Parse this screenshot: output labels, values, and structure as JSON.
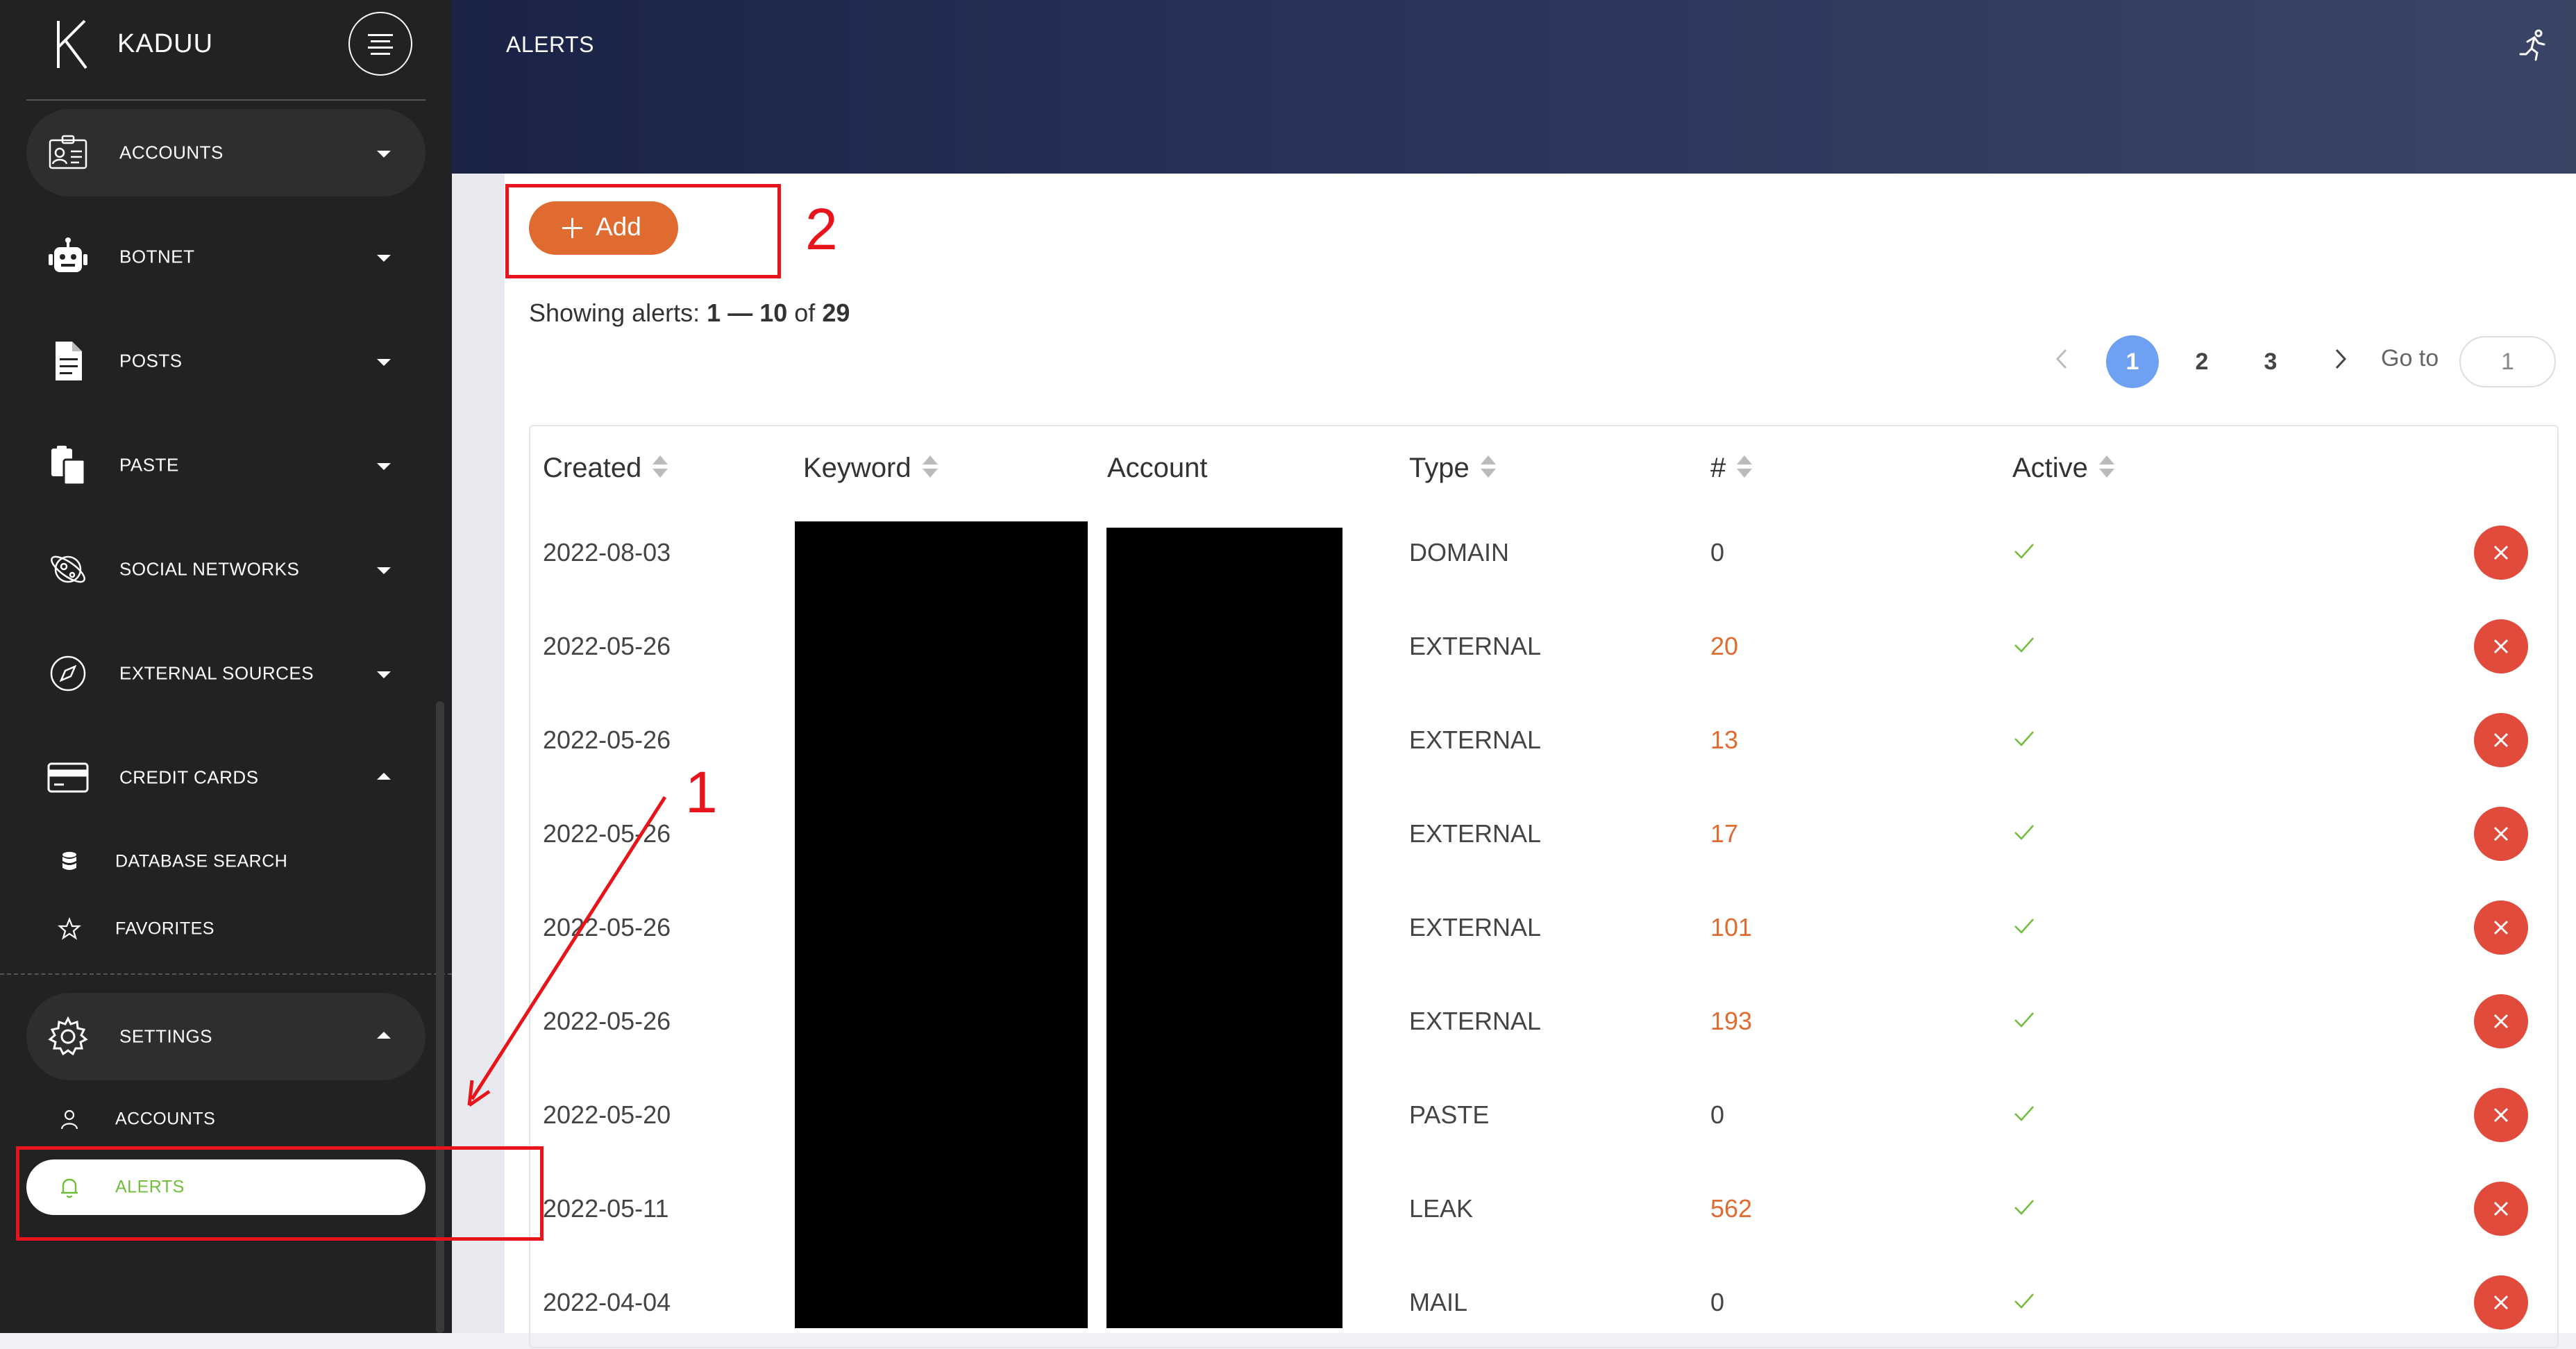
{
  "brand": {
    "name": "KADUU",
    "logo_letter": "K"
  },
  "header": {
    "title": "ALERTS"
  },
  "sidebar": {
    "items": [
      {
        "label": "ACCOUNTS",
        "icon": "id-card-icon",
        "caret": "down",
        "active": true
      },
      {
        "label": "BOTNET",
        "icon": "robot-icon",
        "caret": "down",
        "active": false
      },
      {
        "label": "POSTS",
        "icon": "document-icon",
        "caret": "down",
        "active": false
      },
      {
        "label": "PASTE",
        "icon": "clipboard-icon",
        "caret": "down",
        "active": false
      },
      {
        "label": "SOCIAL NETWORKS",
        "icon": "planet-icon",
        "caret": "down",
        "active": false
      },
      {
        "label": "EXTERNAL SOURCES",
        "icon": "compass-icon",
        "caret": "down",
        "active": false
      },
      {
        "label": "CREDIT CARDS",
        "icon": "credit-card-icon",
        "caret": "up",
        "active": false
      }
    ],
    "credit_sub": [
      {
        "label": "DATABASE SEARCH",
        "icon": "database-icon"
      },
      {
        "label": "FAVORITES",
        "icon": "star-icon"
      }
    ],
    "settings": {
      "label": "SETTINGS",
      "icon": "gear-icon",
      "caret": "up"
    },
    "settings_sub": [
      {
        "label": "ACCOUNTS",
        "icon": "user-icon"
      },
      {
        "label": "ALERTS",
        "icon": "bell-icon",
        "selected": true
      }
    ]
  },
  "toolbar": {
    "add_label": "Add"
  },
  "showing": {
    "prefix": "Showing alerts:",
    "start": "1",
    "dash": "—",
    "end": "10",
    "of": "of",
    "total": "29"
  },
  "pagination": {
    "pages": [
      "1",
      "2",
      "3"
    ],
    "current": "1",
    "goto_label": "Go to",
    "goto_value": "1"
  },
  "table": {
    "columns": [
      "Created",
      "Keyword",
      "Account",
      "Type",
      "#",
      "Active"
    ],
    "rows": [
      {
        "created": "2022-08-03",
        "type": "DOMAIN",
        "count": "0",
        "active": true
      },
      {
        "created": "2022-05-26",
        "type": "EXTERNAL",
        "count": "20",
        "active": true
      },
      {
        "created": "2022-05-26",
        "type": "EXTERNAL",
        "count": "13",
        "active": true
      },
      {
        "created": "2022-05-26",
        "type": "EXTERNAL",
        "count": "17",
        "active": true
      },
      {
        "created": "2022-05-26",
        "type": "EXTERNAL",
        "count": "101",
        "active": true
      },
      {
        "created": "2022-05-26",
        "type": "EXTERNAL",
        "count": "193",
        "active": true
      },
      {
        "created": "2022-05-20",
        "type": "PASTE",
        "count": "0",
        "active": true
      },
      {
        "created": "2022-05-11",
        "type": "LEAK",
        "count": "562",
        "active": true
      },
      {
        "created": "2022-04-04",
        "type": "MAIL",
        "count": "0",
        "active": true
      }
    ]
  },
  "annotations": {
    "label_1": "1",
    "label_2": "2",
    "color": "#e8141b"
  },
  "colors": {
    "accent_orange": "#df6b30",
    "pager_blue": "#6ea1f2",
    "active_green": "#6fbf3b",
    "delete_red": "#e04b3c",
    "sidebar_bg": "#222224",
    "header_navy": "#1a2346"
  }
}
